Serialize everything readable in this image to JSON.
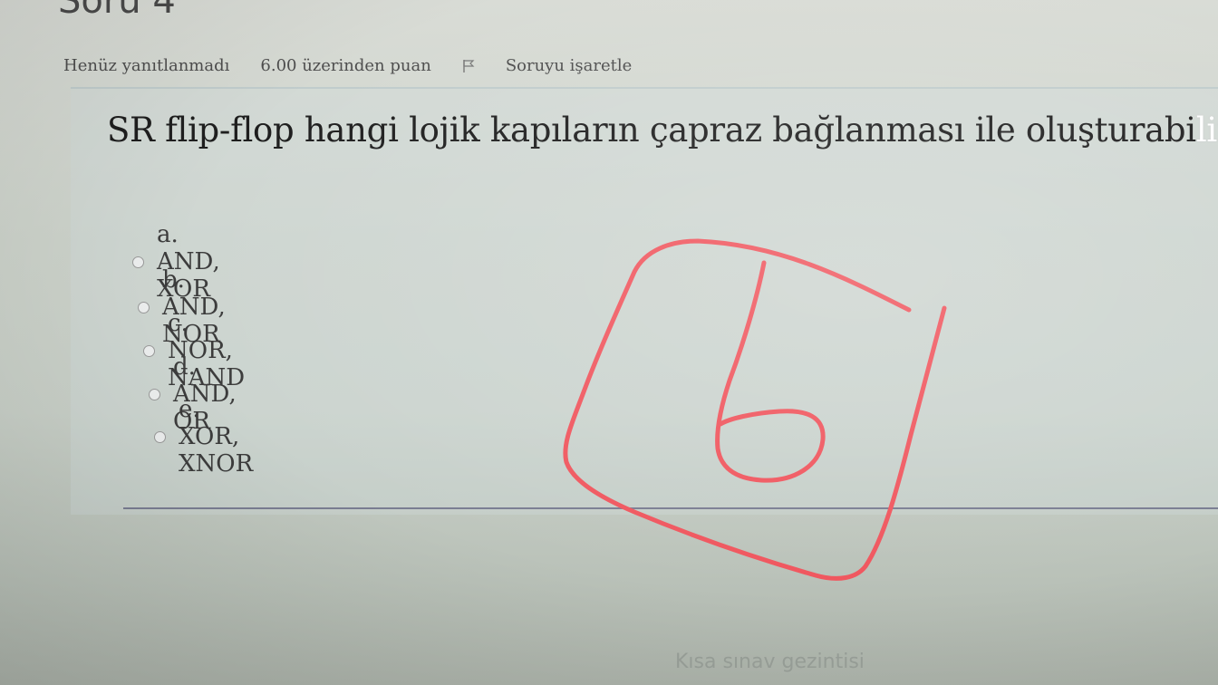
{
  "header": {
    "question_title": "Soru 4",
    "status": "Henüz yanıtlanmadı",
    "points": "6.00 üzerinden puan",
    "flag_label": "Soruyu işaretle"
  },
  "question": {
    "text_main": "SR flip-flop hangi lojik kapıların çapraz bağlanması ile oluşturabi",
    "text_faded": "lir?"
  },
  "options": [
    {
      "label": "a. AND, XOR"
    },
    {
      "label": "b. AND, NOR"
    },
    {
      "label": "c. NOR, NAND"
    },
    {
      "label": "d. AND, OR"
    },
    {
      "label": "e. XOR, XNOR"
    }
  ],
  "footer": {
    "navigation_title": "Kısa sınav gezintisi"
  },
  "annotation": {
    "handwritten_answer": "b",
    "ink_color": "#f0565e"
  }
}
